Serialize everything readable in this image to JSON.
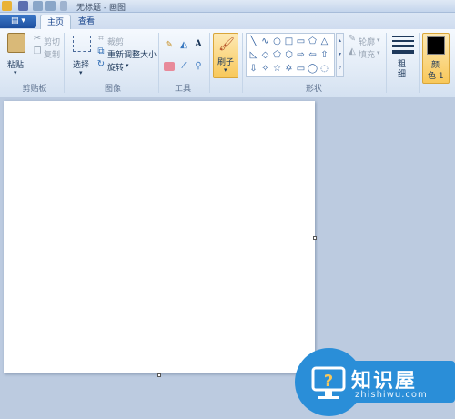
{
  "window": {
    "title": "无标题 - 画图"
  },
  "tabs": [
    {
      "label": "主页"
    },
    {
      "label": "查看"
    }
  ],
  "file_menu": {
    "label": "▤ ▾"
  },
  "clipboard": {
    "paste_label": "粘贴",
    "cut_label": "剪切",
    "copy_label": "复制",
    "group_label": "剪贴板"
  },
  "image": {
    "select_label": "选择",
    "crop_label": "裁剪",
    "resize_label": "重新调整大小",
    "rotate_label": "旋转",
    "group_label": "图像"
  },
  "tools": {
    "group_label": "工具"
  },
  "brushes": {
    "label": "刷子"
  },
  "shapes": {
    "outline_label": "轮廓",
    "fill_label": "填充",
    "group_label": "形状",
    "glyphs": [
      "╲",
      "∿",
      "○",
      "□",
      "▭",
      "⬠",
      "△",
      "◺",
      "◇",
      "⬠",
      "⬡",
      "⇨",
      "⇦",
      "⇧",
      "⇩",
      "✧",
      "☆",
      "✡",
      "▭",
      "◯",
      "◌"
    ]
  },
  "size": {
    "label": "粗细"
  },
  "color1": {
    "label": "颜色 1",
    "label_line1": "颜",
    "label_line2": "色 1",
    "swatch": "#000000"
  },
  "colors": {
    "accent": "#f8c85a",
    "ribbon": "#dfe9f5",
    "workspace": "#bccbe0",
    "watermark": "#2a8ed8"
  },
  "watermark": {
    "cn": "知识屋",
    "en": "zhishiwu.com"
  }
}
